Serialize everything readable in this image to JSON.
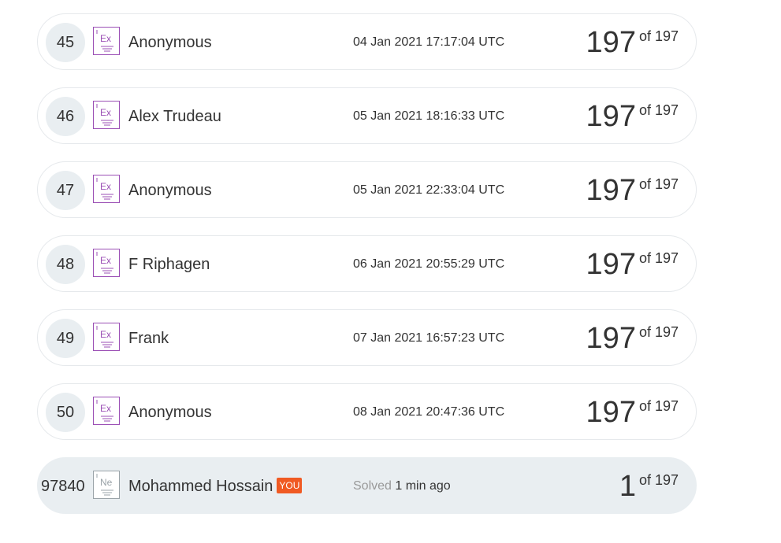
{
  "colors": {
    "row_border": "#e6e9ec",
    "highlight_bg": "#e9eef1",
    "badge_expert": "#9b4fb5",
    "badge_newbie": "#9aa3a8",
    "you_tag": "#f05a23"
  },
  "rows": [
    {
      "rank": "45",
      "badge": {
        "icon": "expert-badge-icon",
        "text": "Ex"
      },
      "name": "Anonymous",
      "date": "04 Jan 2021 17:17:04 UTC",
      "score": "197",
      "of_label": "of 197"
    },
    {
      "rank": "46",
      "badge": {
        "icon": "expert-badge-icon",
        "text": "Ex"
      },
      "name": "Alex Trudeau",
      "date": "05 Jan 2021 18:16:33 UTC",
      "score": "197",
      "of_label": "of 197"
    },
    {
      "rank": "47",
      "badge": {
        "icon": "expert-badge-icon",
        "text": "Ex"
      },
      "name": "Anonymous",
      "date": "05 Jan 2021 22:33:04 UTC",
      "score": "197",
      "of_label": "of 197"
    },
    {
      "rank": "48",
      "badge": {
        "icon": "expert-badge-icon",
        "text": "Ex"
      },
      "name": "F Riphagen",
      "date": "06 Jan 2021 20:55:29 UTC",
      "score": "197",
      "of_label": "of 197"
    },
    {
      "rank": "49",
      "badge": {
        "icon": "expert-badge-icon",
        "text": "Ex"
      },
      "name": "Frank",
      "date": "07 Jan 2021 16:57:23 UTC",
      "score": "197",
      "of_label": "of 197"
    },
    {
      "rank": "50",
      "badge": {
        "icon": "expert-badge-icon",
        "text": "Ex"
      },
      "name": "Anonymous",
      "date": "08 Jan 2021 20:47:36 UTC",
      "score": "197",
      "of_label": "of 197"
    }
  ],
  "you_row": {
    "rank": "97840",
    "badge": {
      "icon": "newbie-badge-icon",
      "text": "Ne"
    },
    "name": "Mohammed Hossain",
    "you_tag": "YOU",
    "solved_label": "Solved",
    "solved_time": "1 min ago",
    "score": "1",
    "of_label": "of 197"
  }
}
